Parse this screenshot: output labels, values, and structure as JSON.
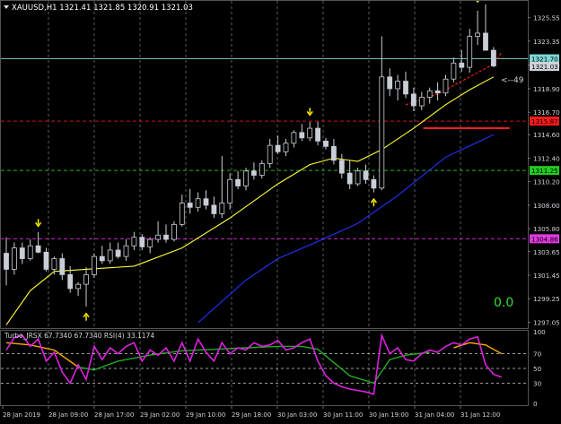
{
  "header": {
    "symbol_line": "XAUUSD,H1  1321.41 1321.85 1320.91 1321.03"
  },
  "main_price_axis": {
    "ticks": [
      "1325.55",
      "1323.35",
      "1321.10",
      "1318.90",
      "1316.70",
      "1314.60",
      "1312.40",
      "1310.20",
      "1308.00",
      "1305.80",
      "1303.65",
      "1301.45",
      "1299.25",
      "1297.05"
    ]
  },
  "price_badges": [
    {
      "text": "1321.70",
      "color": "#7fd6d6",
      "text_color": "#000000"
    },
    {
      "text": "1321.03",
      "color": "#cfd4da",
      "text_color": "#000000"
    },
    {
      "text": "1315.87",
      "color": "#ff1a1a",
      "text_color": "#000000"
    },
    {
      "text": "1311.25",
      "color": "#22cc22",
      "text_color": "#000000"
    },
    {
      "text": "1304.86",
      "color": "#e03ae0",
      "text_color": "#000000"
    }
  ],
  "chart_overlay": {
    "value_label": "0.0",
    "value_label_color": "#33dd33",
    "arrow_label": "<--49"
  },
  "indicator": {
    "label": "Turbo_JRSX 67.7340 67.7340  RSI(4) 33.1174",
    "ticks": [
      "100",
      "70",
      "50",
      "30",
      "0"
    ],
    "rsi_color": "#dd22dd",
    "jrsx_colors": [
      "#ffaa00",
      "#22aa22"
    ]
  },
  "time_axis": {
    "labels": [
      "28 Jan 2019",
      "28 Jan 09:00",
      "28 Jan 17:00",
      "29 Jan 02:00",
      "29 Jan 10:00",
      "29 Jan 18:00",
      "30 Jan 03:00",
      "30 Jan 11:00",
      "30 Jan 19:00",
      "31 Jan 04:00",
      "31 Jan 12:00"
    ]
  },
  "chart_data": {
    "type": "candlestick",
    "title": "",
    "ylim": [
      1296.5,
      1327.2
    ],
    "colors": {
      "candle": "#c9ced6",
      "ma_fast": "#ffff33",
      "ma_slow": "#2233ff",
      "ma_red": "#ff2222"
    },
    "candles": [
      [
        1303.5,
        1305.0,
        1300.5,
        1302.0
      ],
      [
        1302.0,
        1304.5,
        1301.5,
        1304.0
      ],
      [
        1304.0,
        1304.5,
        1302.5,
        1303.0
      ],
      [
        1303.0,
        1304.8,
        1302.8,
        1304.2
      ],
      [
        1304.2,
        1305.5,
        1303.5,
        1303.6
      ],
      [
        1303.6,
        1304.0,
        1301.8,
        1302.0
      ],
      [
        1302.0,
        1303.2,
        1301.5,
        1303.0
      ],
      [
        1303.0,
        1303.5,
        1301.0,
        1301.5
      ],
      [
        1301.5,
        1302.3,
        1299.8,
        1300.2
      ],
      [
        1300.2,
        1300.8,
        1299.5,
        1300.6
      ],
      [
        1300.6,
        1302.2,
        1298.5,
        1301.5
      ],
      [
        1301.5,
        1303.5,
        1301.2,
        1303.2
      ],
      [
        1303.2,
        1304.2,
        1302.5,
        1302.8
      ],
      [
        1302.8,
        1304.5,
        1302.5,
        1303.8
      ],
      [
        1303.8,
        1304.5,
        1303.0,
        1303.2
      ],
      [
        1303.2,
        1304.8,
        1302.8,
        1304.2
      ],
      [
        1304.2,
        1305.5,
        1303.8,
        1305.0
      ],
      [
        1305.0,
        1305.3,
        1303.8,
        1304.1
      ],
      [
        1304.1,
        1305.0,
        1303.5,
        1304.8
      ],
      [
        1304.8,
        1306.5,
        1304.5,
        1305.2
      ],
      [
        1305.2,
        1306.2,
        1304.5,
        1304.8
      ],
      [
        1304.8,
        1306.5,
        1304.6,
        1306.2
      ],
      [
        1306.2,
        1309.0,
        1306.0,
        1308.2
      ],
      [
        1308.2,
        1309.5,
        1307.2,
        1307.8
      ],
      [
        1307.8,
        1309.2,
        1307.4,
        1308.6
      ],
      [
        1308.6,
        1309.4,
        1307.6,
        1308.0
      ],
      [
        1308.0,
        1308.8,
        1306.8,
        1307.2
      ],
      [
        1307.2,
        1312.6,
        1306.8,
        1308.2
      ],
      [
        1308.2,
        1311.0,
        1307.6,
        1310.4
      ],
      [
        1310.4,
        1311.2,
        1309.5,
        1309.8
      ],
      [
        1309.8,
        1311.5,
        1309.4,
        1311.2
      ],
      [
        1311.2,
        1312.0,
        1310.4,
        1310.8
      ],
      [
        1310.8,
        1312.2,
        1310.5,
        1311.9
      ],
      [
        1311.9,
        1314.2,
        1311.5,
        1313.6
      ],
      [
        1313.6,
        1314.5,
        1312.8,
        1313.0
      ],
      [
        1313.0,
        1314.2,
        1312.6,
        1313.8
      ],
      [
        1313.8,
        1315.0,
        1313.4,
        1314.8
      ],
      [
        1314.8,
        1315.6,
        1314.0,
        1314.3
      ],
      [
        1314.3,
        1315.8,
        1314.0,
        1315.2
      ],
      [
        1315.2,
        1315.8,
        1313.6,
        1314.0
      ],
      [
        1314.0,
        1314.3,
        1313.2,
        1313.5
      ],
      [
        1313.5,
        1314.2,
        1311.8,
        1312.2
      ],
      [
        1312.2,
        1312.8,
        1310.5,
        1311.0
      ],
      [
        1311.0,
        1312.2,
        1309.5,
        1310.0
      ],
      [
        1310.0,
        1311.5,
        1309.8,
        1311.2
      ],
      [
        1311.2,
        1311.8,
        1310.0,
        1310.4
      ],
      [
        1310.4,
        1310.8,
        1309.2,
        1309.6
      ],
      [
        1309.6,
        1323.8,
        1309.4,
        1320.0
      ],
      [
        1320.0,
        1320.8,
        1318.2,
        1318.9
      ],
      [
        1318.9,
        1320.2,
        1317.8,
        1319.6
      ],
      [
        1319.6,
        1320.5,
        1318.0,
        1318.4
      ],
      [
        1318.4,
        1319.0,
        1316.8,
        1317.3
      ],
      [
        1317.3,
        1318.6,
        1316.9,
        1318.1
      ],
      [
        1318.1,
        1319.0,
        1317.5,
        1318.7
      ],
      [
        1318.7,
        1319.5,
        1317.8,
        1318.5
      ],
      [
        1318.5,
        1320.2,
        1318.2,
        1319.8
      ],
      [
        1319.8,
        1321.8,
        1319.5,
        1321.3
      ],
      [
        1321.3,
        1322.5,
        1320.5,
        1320.9
      ],
      [
        1320.9,
        1324.5,
        1320.4,
        1323.8
      ],
      [
        1323.8,
        1326.2,
        1323.0,
        1324.1
      ],
      [
        1324.1,
        1326.8,
        1323.4,
        1322.5
      ],
      [
        1322.5,
        1322.8,
        1320.9,
        1321.03
      ]
    ],
    "ma_fast": [
      [
        0,
        1296.8
      ],
      [
        3,
        1300.0
      ],
      [
        6,
        1301.8
      ],
      [
        10,
        1302.0
      ],
      [
        16,
        1302.3
      ],
      [
        22,
        1304.0
      ],
      [
        28,
        1306.8
      ],
      [
        34,
        1310.0
      ],
      [
        38,
        1311.8
      ],
      [
        41,
        1312.4
      ],
      [
        44,
        1312.1
      ],
      [
        47,
        1313.2
      ],
      [
        51,
        1315.2
      ],
      [
        55,
        1317.4
      ],
      [
        58,
        1318.8
      ],
      [
        61,
        1320.0
      ]
    ],
    "ma_slow": [
      [
        24,
        1297.0
      ],
      [
        30,
        1301.0
      ],
      [
        34,
        1303.0
      ],
      [
        39,
        1304.6
      ],
      [
        44,
        1306.3
      ],
      [
        49,
        1308.9
      ],
      [
        55,
        1312.5
      ],
      [
        61,
        1314.6
      ]
    ],
    "ma_red": [
      [
        50,
        1317.4
      ],
      [
        54,
        1318.4
      ],
      [
        58,
        1320.0
      ],
      [
        61,
        1321.2
      ],
      [
        62,
        1322.3
      ]
    ],
    "level_lines": [
      {
        "price": 1321.7,
        "color": "#7fd6d6",
        "style": "solid",
        "width": 0.8
      },
      {
        "price": 1315.87,
        "color": "#cc1414",
        "style": "dashed",
        "width": 1
      },
      {
        "price": 1311.25,
        "color": "#1fb51f",
        "style": "dashed",
        "width": 1
      },
      {
        "price": 1304.86,
        "color": "#d020d0",
        "style": "dashed",
        "width": 1
      }
    ],
    "resistance_segment": {
      "from": 52.2,
      "to": 63,
      "price": 1315.2,
      "color": "#ff1a1a"
    },
    "arrows": [
      {
        "i": 4,
        "price": 1306.2,
        "dir": "down"
      },
      {
        "i": 10,
        "price": 1297.7,
        "dir": "up"
      },
      {
        "i": 38,
        "price": 1316.6,
        "dir": "down"
      },
      {
        "i": 46,
        "price": 1308.4,
        "dir": "up"
      },
      {
        "i": 59,
        "price": 1327.2,
        "dir": "down"
      }
    ],
    "indicator_series": {
      "rsi": [
        [
          0,
          75
        ],
        [
          1,
          92
        ],
        [
          2,
          95
        ],
        [
          3,
          80
        ],
        [
          4,
          90
        ],
        [
          5,
          60
        ],
        [
          6,
          72
        ],
        [
          7,
          45
        ],
        [
          8,
          30
        ],
        [
          9,
          55
        ],
        [
          10,
          35
        ],
        [
          11,
          80
        ],
        [
          12,
          62
        ],
        [
          13,
          78
        ],
        [
          14,
          70
        ],
        [
          15,
          80
        ],
        [
          16,
          85
        ],
        [
          17,
          60
        ],
        [
          18,
          75
        ],
        [
          19,
          68
        ],
        [
          20,
          78
        ],
        [
          21,
          60
        ],
        [
          22,
          85
        ],
        [
          23,
          60
        ],
        [
          24,
          90
        ],
        [
          25,
          72
        ],
        [
          26,
          60
        ],
        [
          27,
          85
        ],
        [
          28,
          70
        ],
        [
          29,
          78
        ],
        [
          30,
          75
        ],
        [
          31,
          85
        ],
        [
          32,
          80
        ],
        [
          33,
          82
        ],
        [
          34,
          88
        ],
        [
          35,
          75
        ],
        [
          36,
          78
        ],
        [
          37,
          85
        ],
        [
          38,
          90
        ],
        [
          39,
          60
        ],
        [
          40,
          40
        ],
        [
          41,
          30
        ],
        [
          42,
          25
        ],
        [
          43,
          22
        ],
        [
          44,
          20
        ],
        [
          45,
          18
        ],
        [
          46,
          15
        ],
        [
          47,
          95
        ],
        [
          48,
          70
        ],
        [
          49,
          78
        ],
        [
          50,
          62
        ],
        [
          51,
          60
        ],
        [
          52,
          70
        ],
        [
          53,
          75
        ],
        [
          54,
          72
        ],
        [
          55,
          80
        ],
        [
          56,
          85
        ],
        [
          57,
          82
        ],
        [
          58,
          90
        ],
        [
          59,
          93
        ],
        [
          60,
          55
        ],
        [
          61,
          42
        ],
        [
          62,
          38
        ]
      ],
      "jrsx": [
        [
          0,
          85
        ],
        [
          3,
          82
        ],
        [
          6,
          75
        ],
        [
          9,
          52
        ],
        [
          11,
          48
        ],
        [
          14,
          60
        ],
        [
          18,
          68
        ],
        [
          22,
          74
        ],
        [
          26,
          76
        ],
        [
          30,
          78
        ],
        [
          34,
          80
        ],
        [
          37,
          80
        ],
        [
          39,
          76
        ],
        [
          41,
          58
        ],
        [
          43,
          40
        ],
        [
          46,
          30
        ],
        [
          48,
          62
        ],
        [
          50,
          68
        ],
        [
          53,
          72
        ],
        [
          56,
          78
        ],
        [
          58,
          85
        ],
        [
          60,
          82
        ],
        [
          62,
          70
        ]
      ],
      "green_range": [
        9,
        54
      ]
    }
  }
}
